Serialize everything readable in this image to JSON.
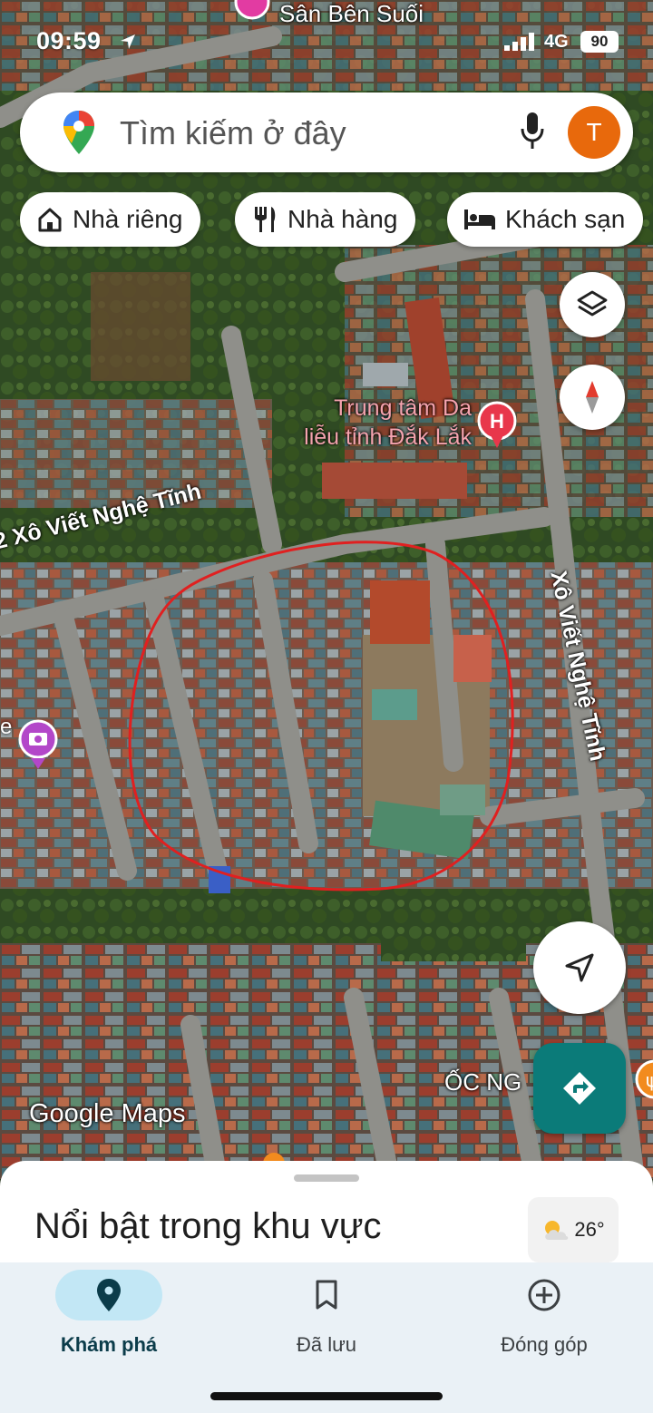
{
  "status_bar": {
    "time": "09:59",
    "network": "4G",
    "battery": "90"
  },
  "search": {
    "placeholder": "Tìm kiếm ở đây",
    "avatar_letter": "T"
  },
  "chips": [
    {
      "label": "Nhà riêng",
      "icon": "home-icon"
    },
    {
      "label": "Nhà hàng",
      "icon": "restaurant-icon"
    },
    {
      "label": "Khách sạn",
      "icon": "hotel-icon"
    }
  ],
  "map_labels": {
    "top_place": "Sân Bên Suối",
    "hospital_line1": "Trung tâm Da",
    "hospital_line2": "liễu tỉnh Đắk Lắk",
    "street_left": "2 Xô Viết Nghệ Tĩnh",
    "street_right": "Xô Viết Nghệ Tĩnh",
    "place_bottom": "ỐC NG",
    "left_edge_e": "e",
    "watermark": "Google Maps"
  },
  "sheet": {
    "title": "Nổi bật trong khu vực",
    "temperature": "26°"
  },
  "nav": {
    "items": [
      {
        "label": "Khám phá",
        "icon": "location-pin-icon",
        "active": true
      },
      {
        "label": "Đã lưu",
        "icon": "bookmark-icon",
        "active": false
      },
      {
        "label": "Đóng góp",
        "icon": "add-circle-icon",
        "active": false
      }
    ]
  },
  "colors": {
    "accent": "#0b7b79",
    "avatar": "#e8690c",
    "nav_active": "#c2e7f5",
    "hospital": "#e8374b",
    "drawn_circle": "#e02020"
  }
}
